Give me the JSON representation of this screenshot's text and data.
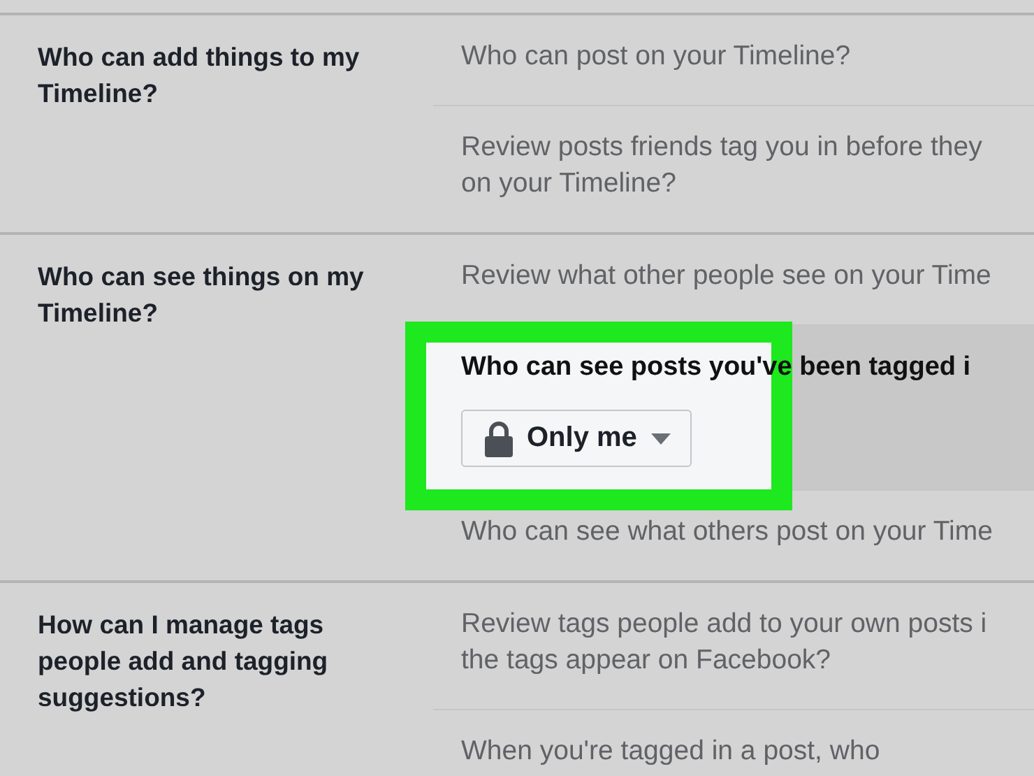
{
  "sections": [
    {
      "label": "Who can add things to my Timeline?",
      "items": [
        {
          "kind": "link",
          "lines": [
            "Who can post on your Timeline?"
          ]
        },
        {
          "kind": "link",
          "lines": [
            "Review posts friends tag you in before they",
            "on your Timeline?"
          ]
        }
      ]
    },
    {
      "label": "Who can see things on my Timeline?",
      "items": [
        {
          "kind": "link",
          "lines": [
            "Review what other people see on your Time"
          ]
        },
        {
          "kind": "expanded",
          "title": "Who can see posts you've been tagged i",
          "button": "Only me",
          "highlighted": true
        },
        {
          "kind": "link",
          "lines": [
            "Who can see what others post on your Time"
          ]
        }
      ]
    },
    {
      "label": "How can I manage tags people add and tagging suggestions?",
      "items": [
        {
          "kind": "link",
          "lines": [
            "Review tags people add to your own posts i",
            "the tags appear on Facebook?"
          ]
        },
        {
          "kind": "link",
          "lines": [
            "When you're tagged in a post, who"
          ]
        }
      ]
    }
  ]
}
